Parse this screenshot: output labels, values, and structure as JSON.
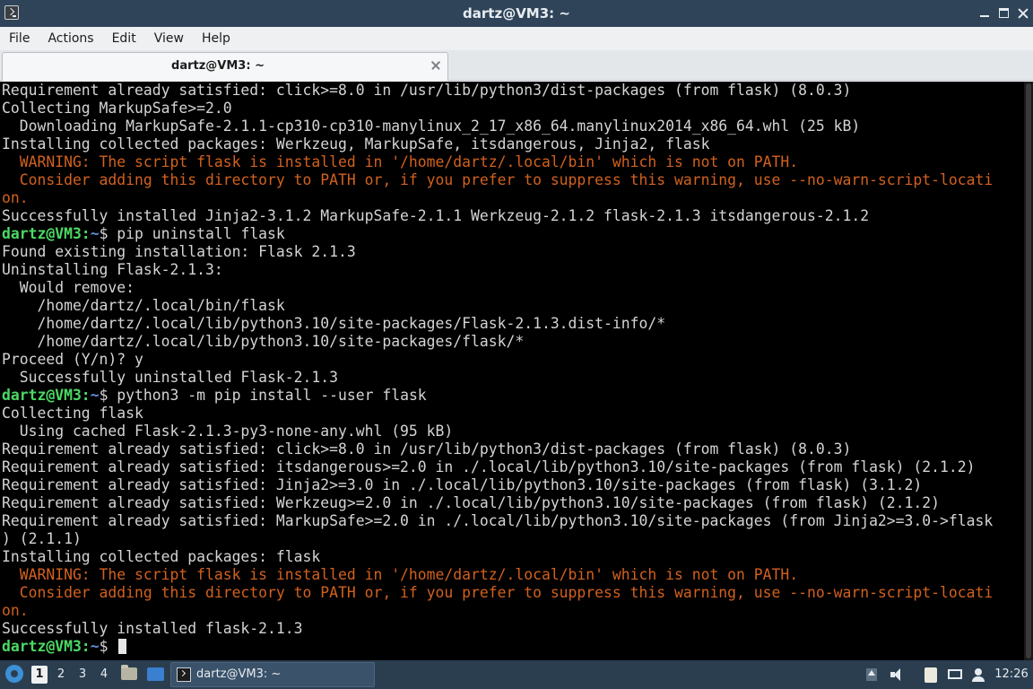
{
  "window": {
    "title": "dartz@VM3: ~"
  },
  "menubar": {
    "items": [
      "File",
      "Actions",
      "Edit",
      "View",
      "Help"
    ]
  },
  "tabs": [
    {
      "label": "dartz@VM3: ~"
    }
  ],
  "terminal": {
    "prompt_user": "dartz@VM3",
    "prompt_path": "~",
    "lines": [
      "Requirement already satisfied: click>=8.0 in /usr/lib/python3/dist-packages (from flask) (8.0.3)",
      "Collecting MarkupSafe>=2.0",
      "  Downloading MarkupSafe-2.1.1-cp310-cp310-manylinux_2_17_x86_64.manylinux2014_x86_64.whl (25 kB)",
      "Installing collected packages: Werkzeug, MarkupSafe, itsdangerous, Jinja2, flask",
      "  WARNING: The script flask is installed in '/home/dartz/.local/bin' which is not on PATH.",
      "  Consider adding this directory to PATH or, if you prefer to suppress this warning, use --no-warn-script-locati",
      "on.",
      "Successfully installed Jinja2-3.1.2 MarkupSafe-2.1.1 Werkzeug-2.1.2 flask-2.1.3 itsdangerous-2.1.2",
      "$ pip uninstall flask",
      "Found existing installation: Flask 2.1.3",
      "Uninstalling Flask-2.1.3:",
      "  Would remove:",
      "    /home/dartz/.local/bin/flask",
      "    /home/dartz/.local/lib/python3.10/site-packages/Flask-2.1.3.dist-info/*",
      "    /home/dartz/.local/lib/python3.10/site-packages/flask/*",
      "Proceed (Y/n)? y",
      "  Successfully uninstalled Flask-2.1.3",
      "$ python3 -m pip install --user flask",
      "Collecting flask",
      "  Using cached Flask-2.1.3-py3-none-any.whl (95 kB)",
      "Requirement already satisfied: click>=8.0 in /usr/lib/python3/dist-packages (from flask) (8.0.3)",
      "Requirement already satisfied: itsdangerous>=2.0 in ./.local/lib/python3.10/site-packages (from flask) (2.1.2)",
      "Requirement already satisfied: Jinja2>=3.0 in ./.local/lib/python3.10/site-packages (from flask) (3.1.2)",
      "Requirement already satisfied: Werkzeug>=2.0 in ./.local/lib/python3.10/site-packages (from flask) (2.1.2)",
      "Requirement already satisfied: MarkupSafe>=2.0 in ./.local/lib/python3.10/site-packages (from Jinja2>=3.0->flask",
      ") (2.1.1)",
      "Installing collected packages: flask",
      "  WARNING: The script flask is installed in '/home/dartz/.local/bin' which is not on PATH.",
      "  Consider adding this directory to PATH or, if you prefer to suppress this warning, use --no-warn-script-locati",
      "on.",
      "Successfully installed flask-2.1.3",
      "$ "
    ]
  },
  "taskbar": {
    "workspaces": [
      "1",
      "2",
      "3",
      "4"
    ],
    "task_label": "dartz@VM3: ~",
    "clock": "12:26"
  }
}
